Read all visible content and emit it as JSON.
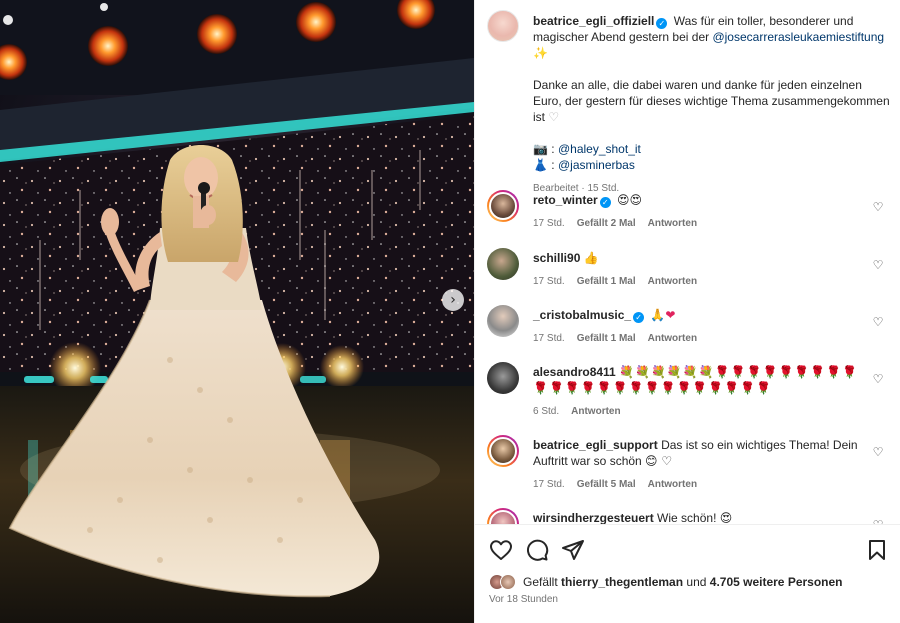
{
  "post": {
    "username": "beatrice_egli_offiziell",
    "caption_line1": "Was für ein toller, besonderer und magischer Abend gestern bei der ",
    "caption_mention": "@josecarrerasleukaemiestiftung",
    "caption_emoji": "✨",
    "caption_para2": "Danke an alle, die dabei waren und danke für jeden einzelnen Euro, der gestern für dieses wichtige Thema zusammengekommen ist ",
    "caption_para2_emoji": "♡",
    "credit_photo_emoji": "📷",
    "credit_photo": "@haley_shot_it",
    "credit_dress_emoji": "👗",
    "credit_dress": "@jasminerbas",
    "edited": "Bearbeitet",
    "edited_time": "15 Std."
  },
  "comments": [
    {
      "username": "reto_winter",
      "verified": true,
      "text": "",
      "emoji": "😍😍",
      "time": "17 Std.",
      "likes": "Gefällt 2 Mal",
      "reply": "Antworten"
    },
    {
      "username": "schilli90",
      "verified": false,
      "text": "",
      "emoji": "👍",
      "time": "17 Std.",
      "likes": "Gefällt 1 Mal",
      "reply": "Antworten"
    },
    {
      "username": "_cristobalmusic_",
      "verified": true,
      "text": "",
      "emoji": "🙏❤",
      "time": "17 Std.",
      "likes": "Gefällt 1 Mal",
      "reply": "Antworten"
    },
    {
      "username": "alesandro8411",
      "verified": false,
      "text": "",
      "emoji": "💐💐💐💐💐💐🌹🌹🌹🌹🌹🌹🌹🌹🌹🌹🌹🌹🌹🌹🌹🌹🌹🌹🌹🌹🌹🌹🌹🌹",
      "time": "6 Std.",
      "likes": "",
      "reply": "Antworten"
    },
    {
      "username": "beatrice_egli_support",
      "verified": false,
      "text": "Das ist so ein wichtiges Thema! Dein Auftritt war so schön ",
      "emoji": "😊 ♡",
      "time": "17 Std.",
      "likes": "Gefällt 5 Mal",
      "reply": "Antworten"
    },
    {
      "username": "wirsindherzgesteuert",
      "verified": false,
      "text": "Wie schön! ",
      "emoji": "😍",
      "time": "",
      "likes": "",
      "reply": ""
    }
  ],
  "footer": {
    "liked_prefix": "Gefällt ",
    "liked_user": "thierry_thegentleman",
    "liked_middle": " und ",
    "liked_count": "4.705 weitere Personen",
    "time": "Vor 18 Stunden"
  },
  "icons": {
    "carousel_next": "›",
    "comment_like": "♡"
  },
  "colors": {
    "link": "#00376b",
    "verified": "#0095f6",
    "meta": "#737373",
    "text": "#262626"
  }
}
